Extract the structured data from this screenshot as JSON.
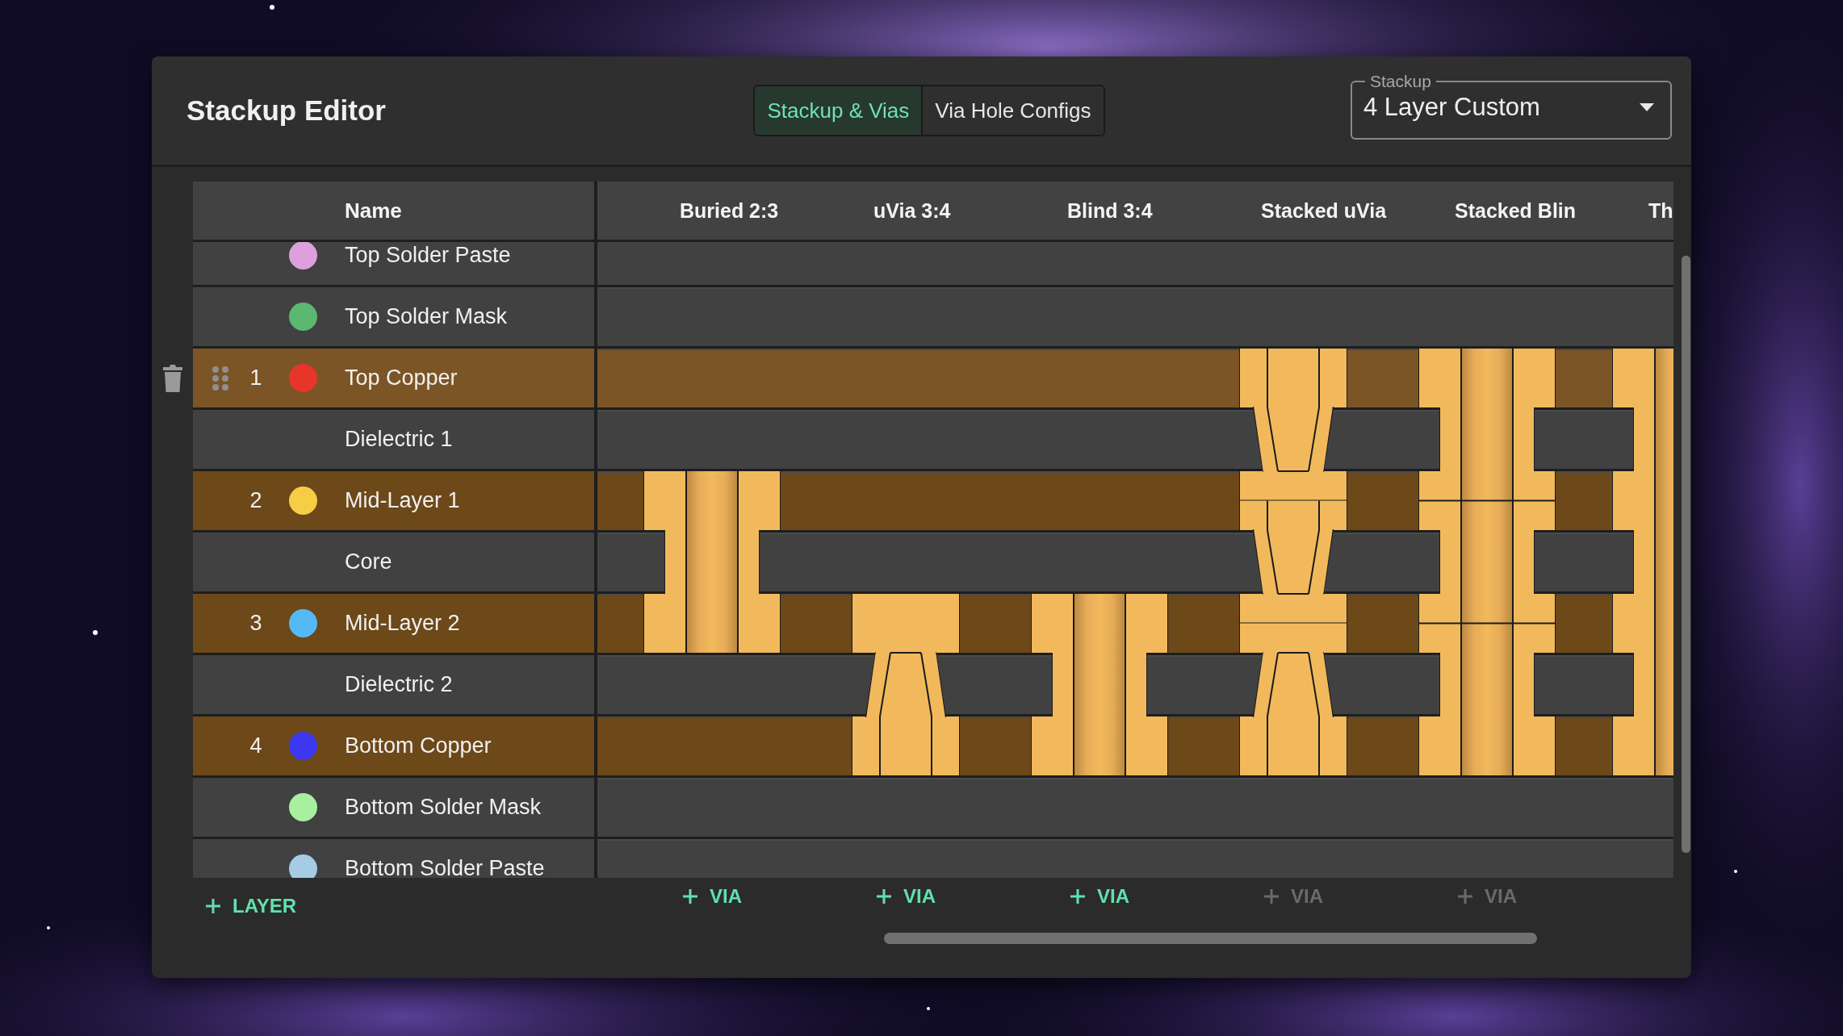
{
  "window": {
    "title": "Stackup Editor"
  },
  "tabs": [
    {
      "label": "Stackup & Vias",
      "selected": true
    },
    {
      "label": "Via Hole Configs",
      "selected": false
    }
  ],
  "stackup_select": {
    "label": "Stackup",
    "value": "4 Layer Custom"
  },
  "table": {
    "name_header": "Name",
    "layers": [
      {
        "kind": "surface",
        "name": "Top Solder Paste",
        "color": "#dda0dd",
        "hovered": false
      },
      {
        "kind": "surface",
        "name": "Top Solder Mask",
        "color": "#5bb870",
        "hovered": false
      },
      {
        "kind": "copper",
        "number": "1",
        "name": "Top Copper",
        "color": "#e8352a",
        "hovered": true
      },
      {
        "kind": "dielectric",
        "name": "Dielectric 1",
        "hovered": false
      },
      {
        "kind": "copper",
        "number": "2",
        "name": "Mid-Layer 1",
        "color": "#f6cd45",
        "hovered": false
      },
      {
        "kind": "dielectric",
        "name": "Core",
        "hovered": false
      },
      {
        "kind": "copper",
        "number": "3",
        "name": "Mid-Layer 2",
        "color": "#55b9f8",
        "hovered": false
      },
      {
        "kind": "dielectric",
        "name": "Dielectric 2",
        "hovered": false
      },
      {
        "kind": "copper",
        "number": "4",
        "name": "Bottom Copper",
        "color": "#3d38f0",
        "hovered": false
      },
      {
        "kind": "surface",
        "name": "Bottom Solder Mask",
        "color": "#a8f0a0",
        "hovered": false
      },
      {
        "kind": "surface",
        "name": "Bottom Solder Paste",
        "color": "#a6cbe4",
        "hovered": false
      }
    ],
    "vias": [
      {
        "name": "Buried 2:3",
        "kind": "drill",
        "layers": [
          false,
          true,
          true,
          false
        ],
        "add_button": {
          "label": "VIA",
          "disabled": false
        }
      },
      {
        "name": "uVia 3:4",
        "kind": "micro",
        "layers": [
          false,
          false,
          true,
          true
        ],
        "add_button": {
          "label": "VIA",
          "disabled": false
        }
      },
      {
        "name": "Blind 3:4",
        "kind": "drill",
        "layers": [
          false,
          false,
          true,
          true
        ],
        "add_button": {
          "label": "VIA",
          "disabled": false
        }
      },
      {
        "name": "Stacked uVia",
        "kind": "micro-stack",
        "layers": [
          true,
          true,
          true,
          true
        ],
        "add_button": {
          "label": "VIA",
          "disabled": true
        }
      },
      {
        "name": "Stacked Blin",
        "kind": "drill-stack",
        "layers": [
          true,
          true,
          true,
          true
        ],
        "add_button": {
          "label": "VIA",
          "disabled": true
        }
      },
      {
        "name": "Th",
        "kind": "drill",
        "layers": [
          true,
          true,
          true,
          true
        ]
      }
    ]
  },
  "add_layer": {
    "label": "LAYER"
  }
}
